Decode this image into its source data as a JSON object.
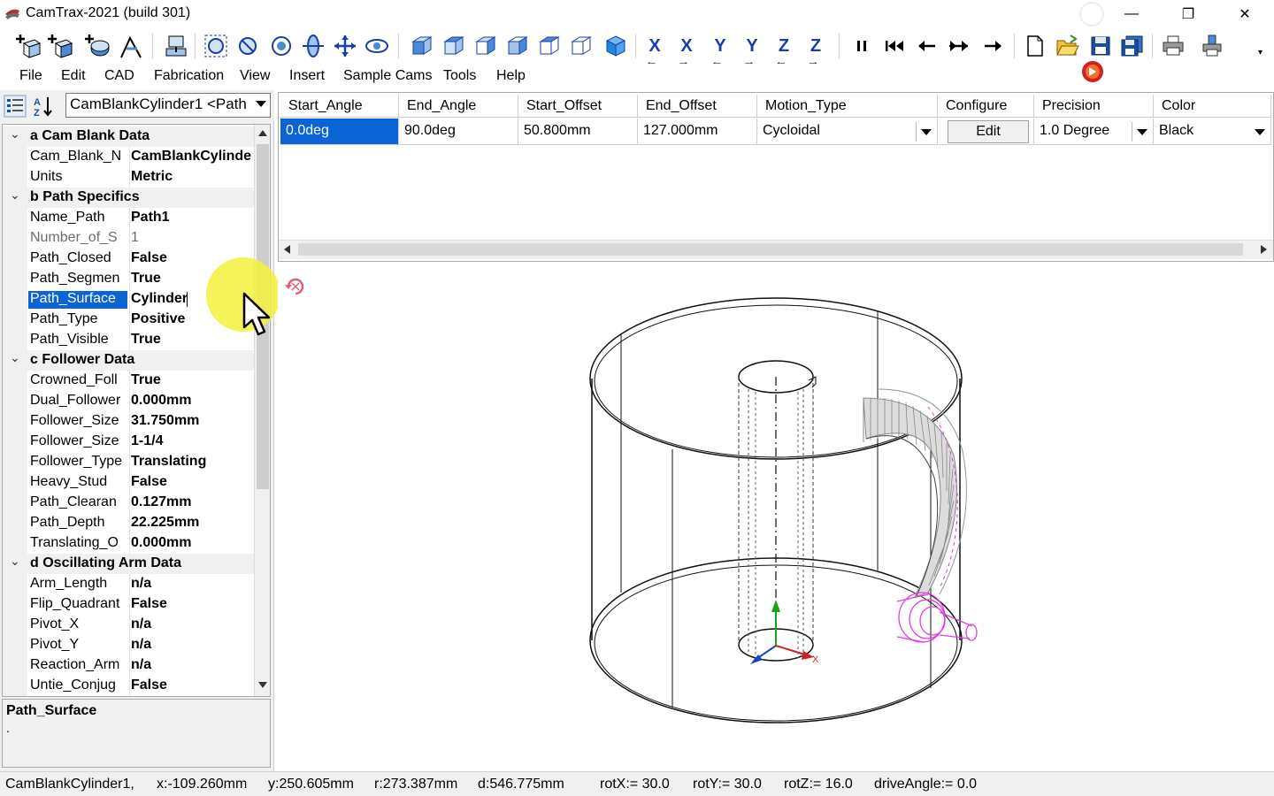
{
  "window": {
    "title": "CamTrax-2021  (build 301)",
    "min": "—",
    "max": "❐",
    "close": "✕"
  },
  "toolbar": {
    "icons": [
      "new-part-icon",
      "add-part-icon",
      "add-cam-icon",
      "add-follower-icon",
      "export-icon",
      "zoom-fit-icon",
      "zoom-window-icon",
      "zoom-extents-icon",
      "rotate-view-icon",
      "pan-icon",
      "orbit-icon",
      "view-front-icon",
      "view-back-icon",
      "view-left-icon",
      "view-right-icon",
      "view-top-icon",
      "view-bottom-icon",
      "view-iso-icon",
      "pause-icon",
      "rewind-icon",
      "step-back-icon",
      "fast-forward-icon",
      "step-forward-icon",
      "new-file-icon",
      "open-file-icon",
      "save-icon",
      "save-all-icon",
      "print-icon",
      "print-setup-icon"
    ],
    "axis_buttons": [
      {
        "letter": "X",
        "dir": "←"
      },
      {
        "letter": "X",
        "dir": "→"
      },
      {
        "letter": "Y",
        "dir": "←"
      },
      {
        "letter": "Y",
        "dir": "→"
      },
      {
        "letter": "Z",
        "dir": "←"
      },
      {
        "letter": "Z",
        "dir": "→"
      }
    ]
  },
  "menu": {
    "items": [
      "File",
      "Edit",
      "CAD",
      "Fabrication",
      "View",
      "Insert",
      "Sample Cams",
      "Tools",
      "Help"
    ]
  },
  "object_selector": {
    "value": "CamBlankCylinder1 <Path"
  },
  "properties": {
    "cat_a": {
      "name": "a Cam Blank Data",
      "rows": [
        {
          "name": "Cam_Blank_N",
          "value": "CamBlankCylinde"
        },
        {
          "name": "Units",
          "value": "Metric"
        }
      ]
    },
    "cat_b": {
      "name": "b Path Specifics",
      "rows": [
        {
          "name": "Name_Path",
          "value": "Path1"
        },
        {
          "name": "Number_of_S",
          "value": "1"
        },
        {
          "name": "Path_Closed",
          "value": "False"
        },
        {
          "name": "Path_Segmen",
          "value": "True"
        },
        {
          "name": "Path_Surface",
          "value": "Cylinder"
        },
        {
          "name": "Path_Type",
          "value": "Positive"
        },
        {
          "name": "Path_Visible",
          "value": "True"
        }
      ]
    },
    "cat_c": {
      "name": "c Follower Data",
      "rows": [
        {
          "name": "Crowned_Foll",
          "value": "True"
        },
        {
          "name": "Dual_Follower",
          "value": "0.000mm"
        },
        {
          "name": "Follower_Size",
          "value": "31.750mm"
        },
        {
          "name": "Follower_Size",
          "value": "1-1/4"
        },
        {
          "name": "Follower_Type",
          "value": "Translating"
        },
        {
          "name": "Heavy_Stud",
          "value": "False"
        },
        {
          "name": "Path_Clearan",
          "value": "0.127mm"
        },
        {
          "name": "Path_Depth",
          "value": "22.225mm"
        },
        {
          "name": "Translating_O",
          "value": "0.000mm"
        }
      ]
    },
    "cat_d": {
      "name": "d Oscillating Arm Data",
      "rows": [
        {
          "name": "Arm_Length",
          "value": "n/a"
        },
        {
          "name": "Flip_Quadrant",
          "value": "False"
        },
        {
          "name": "Pivot_X",
          "value": "n/a"
        },
        {
          "name": "Pivot_Y",
          "value": "n/a"
        },
        {
          "name": "Reaction_Arm",
          "value": "n/a"
        },
        {
          "name": "Untie_Conjug",
          "value": "False"
        }
      ]
    }
  },
  "description": {
    "title": "Path_Surface",
    "text": "."
  },
  "segments": {
    "headers": [
      "Start_Angle",
      "End_Angle",
      "Start_Offset",
      "End_Offset",
      "Motion_Type",
      "Configure",
      "Precision",
      "Color"
    ],
    "row": {
      "start_angle": "0.0deg",
      "end_angle": "90.0deg",
      "start_offset": "50.800mm",
      "end_offset": "127.000mm",
      "motion_type": "Cycloidal",
      "configure": "Edit",
      "precision": "1.0 Degree",
      "color": "Black"
    }
  },
  "status": {
    "object": "CamBlankCylinder1,",
    "x": "x:-109.260mm",
    "y": "y:250.605mm",
    "r": "r:273.387mm",
    "d": "d:546.775mm",
    "rotX": "rotX:= 30.0",
    "rotY": "rotY:= 30.0",
    "rotZ": "rotZ:= 16.0",
    "drive": "driveAngle:= 0.0"
  },
  "colors": {
    "selection": "#0a64d6",
    "highlight": "#f5f03c",
    "follower": "#e040e0",
    "axis_y": "#1aa01a",
    "axis_x": "#d02020",
    "axis_z": "#2040d0"
  }
}
